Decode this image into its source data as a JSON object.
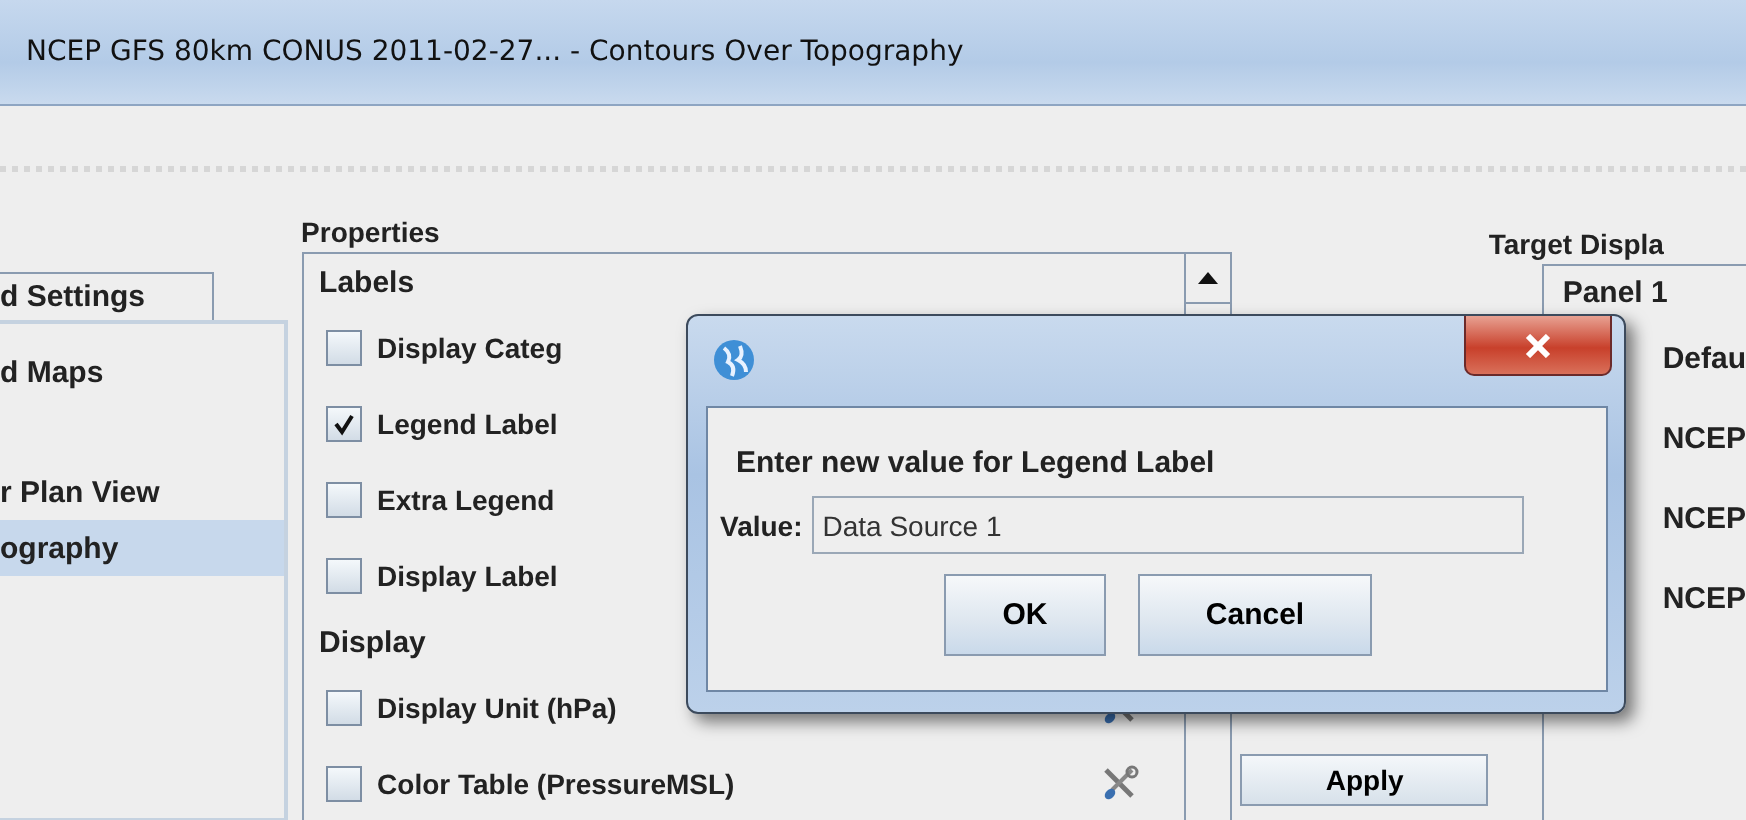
{
  "window": {
    "title": "NCEP GFS 80km CONUS 2011-02-27... - Contours Over Topography"
  },
  "left_panel": {
    "tab": {
      "label": "d Settings",
      "selected": true
    },
    "items": [
      {
        "label": "d Maps",
        "selected": false
      },
      {
        "label": "r Plan View",
        "selected": false
      },
      {
        "label": "ography",
        "selected": true
      }
    ]
  },
  "properties": {
    "title": "Properties",
    "sections": [
      {
        "heading": "Labels",
        "rows": [
          {
            "label": "Display Categ",
            "checked": false,
            "kind": "plain"
          },
          {
            "label": "Legend Label",
            "checked": true,
            "kind": "plain"
          },
          {
            "label": "Extra Legend",
            "checked": false,
            "kind": "plain"
          },
          {
            "label": "Display Label",
            "checked": false,
            "kind": "plain"
          }
        ]
      },
      {
        "heading": "Display",
        "rows": [
          {
            "label": "Display Unit (hPa)",
            "checked": false,
            "kind": "tool"
          },
          {
            "label": "Color Table (PressureMSL)",
            "checked": false,
            "kind": "tool"
          }
        ]
      }
    ]
  },
  "apply_button": {
    "label": "Apply"
  },
  "target_display": {
    "title": "Target Displa",
    "tree": [
      {
        "label": "Panel 1",
        "children": [
          {
            "label": "Defau"
          },
          {
            "label": "NCEP"
          },
          {
            "label": "NCEP"
          },
          {
            "label": "NCEP"
          }
        ]
      }
    ]
  },
  "dialog": {
    "prompt": "Enter new value for Legend Label",
    "value_label": "Value:",
    "value": "Data Source 1",
    "buttons": [
      "OK",
      "Cancel"
    ]
  }
}
